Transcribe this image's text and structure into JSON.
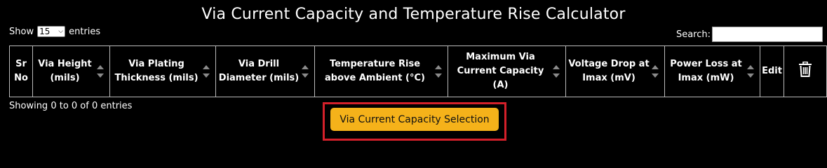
{
  "page": {
    "title": "Via Current Capacity and Temperature Rise Calculator"
  },
  "length_control": {
    "show_label": "Show",
    "selected": "15",
    "entries_label": "entries"
  },
  "search": {
    "label": "Search:",
    "value": ""
  },
  "table": {
    "columns": [
      {
        "label": "Sr No",
        "sortable": false
      },
      {
        "label": "Via Height (mils)",
        "sortable": true
      },
      {
        "label": "Via Plating Thickness (mils)",
        "sortable": true
      },
      {
        "label": "Via Drill Diameter (mils)",
        "sortable": true
      },
      {
        "label": "Temperature Rise above Ambient (°C)",
        "sortable": true
      },
      {
        "label": "Maximum Via Current Capacity (A)",
        "sortable": true
      },
      {
        "label": "Voltage Drop at Imax (mV)",
        "sortable": true
      },
      {
        "label": "Power Loss at Imax (mW)",
        "sortable": true
      },
      {
        "label": "Edit",
        "sortable": false
      },
      {
        "icon": "trash-icon",
        "sortable": false
      }
    ],
    "rows": [],
    "info": "Showing 0 to 0 of 0 entries"
  },
  "action": {
    "button_label": "Via Current Capacity Selection",
    "highlight_color": "#d4202a",
    "button_color": "#f5b21a"
  }
}
